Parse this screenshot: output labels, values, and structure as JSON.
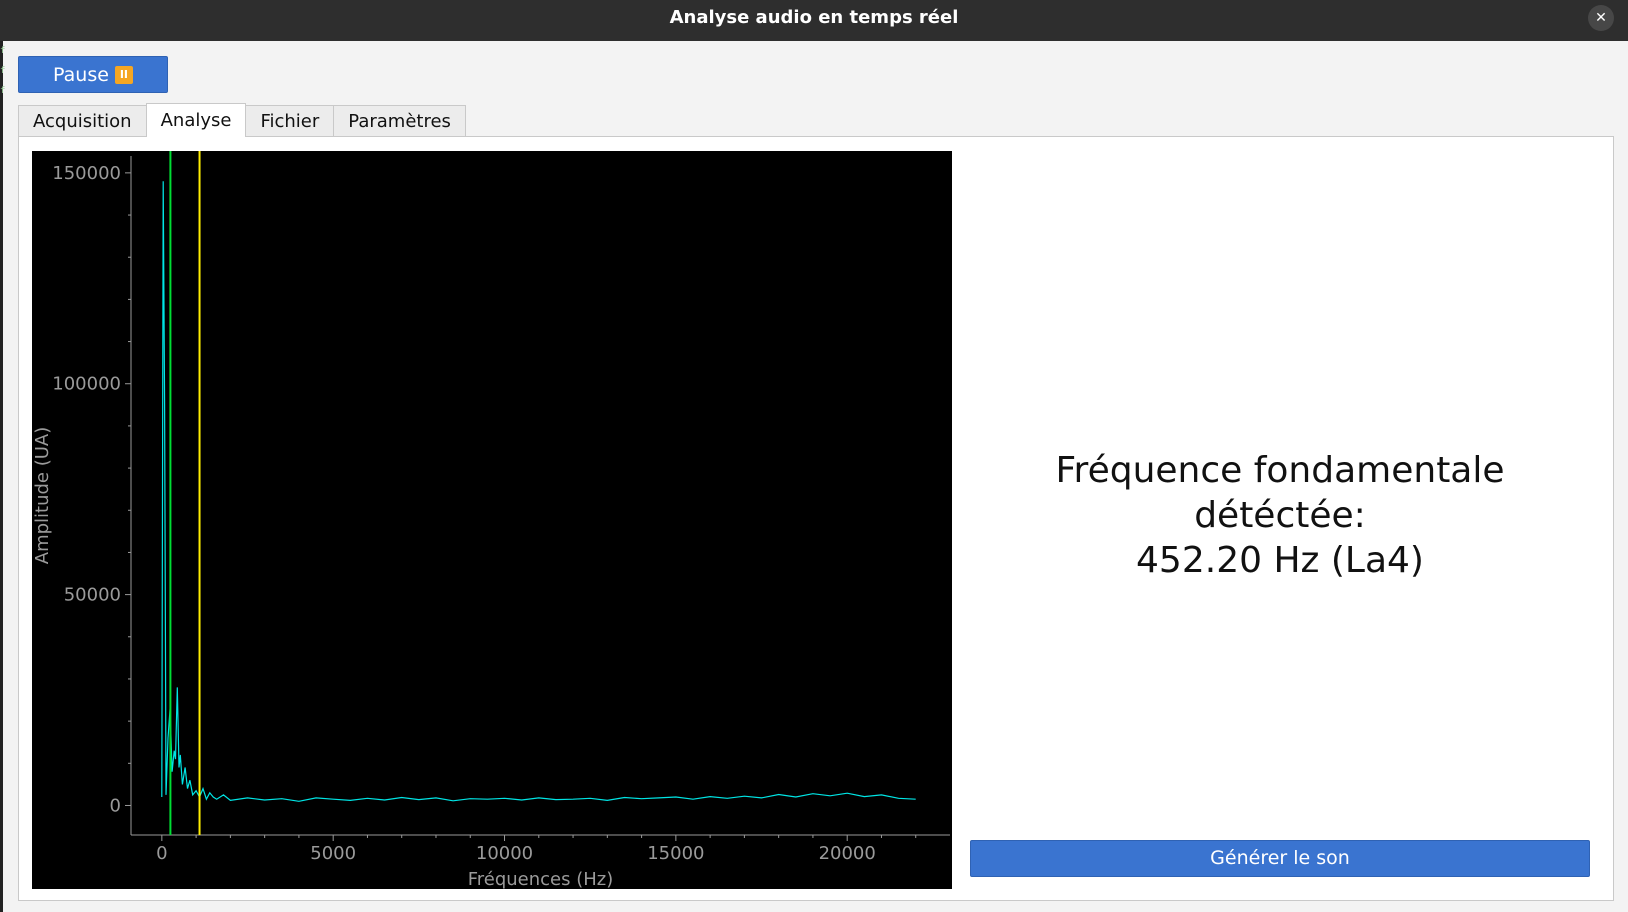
{
  "window": {
    "title": "Analyse audio en temps réel",
    "close_glyph": "✕"
  },
  "toolbar": {
    "pause_label": "Pause",
    "pause_icon": "pause-icon",
    "pause_icon_glyph": "II"
  },
  "tabs": [
    {
      "label": "Acquisition",
      "active": false
    },
    {
      "label": "Analyse",
      "active": true
    },
    {
      "label": "Fichier",
      "active": false
    },
    {
      "label": "Paramètres",
      "active": false
    }
  ],
  "result": {
    "line1": "Fréquence fondamentale détéctée:",
    "line2": "452.20 Hz (La4)"
  },
  "generate_button": "Générer le son",
  "colors": {
    "accent": "#3a74d0",
    "spectrum": "#00e5e5",
    "marker_green": "#00dd33",
    "marker_yellow": "#ffee00"
  },
  "chart_data": {
    "type": "line",
    "title": "",
    "xlabel": "Fréquences (Hz)",
    "ylabel": "Amplitude (UA)",
    "xlim": [
      -900,
      23000
    ],
    "ylim": [
      -7000,
      154000
    ],
    "xticks": [
      0,
      5000,
      10000,
      15000,
      20000
    ],
    "yticks": [
      0,
      50000,
      100000,
      150000
    ],
    "grid": false,
    "markers": [
      {
        "x": 250,
        "color": "#00dd33"
      },
      {
        "x": 1100,
        "color": "#ffee00"
      }
    ],
    "series": [
      {
        "x": [
          0,
          40,
          80,
          120,
          180,
          240,
          300,
          360,
          400,
          452,
          500,
          540,
          600,
          680,
          750,
          820,
          900,
          1000,
          1100,
          1200,
          1300,
          1400,
          1500,
          1600,
          1800,
          2000,
          2500,
          3000,
          3500,
          4000,
          4500,
          5000,
          5500,
          6000,
          6500,
          7000,
          7500,
          8000,
          8500,
          9000,
          9500,
          10000,
          10500,
          11000,
          11500,
          12000,
          12500,
          13000,
          13500,
          14000,
          14500,
          15000,
          15500,
          16000,
          16500,
          17000,
          17500,
          18000,
          18500,
          19000,
          19500,
          20000,
          20500,
          21000,
          21500,
          22000
        ],
        "y": [
          2000,
          148000,
          95000,
          2500,
          16000,
          23000,
          8000,
          13000,
          11000,
          28000,
          9000,
          12000,
          5000,
          9000,
          4000,
          6000,
          2500,
          3500,
          2000,
          4000,
          1500,
          3000,
          2000,
          1500,
          2500,
          1200,
          1800,
          1300,
          1600,
          1000,
          1800,
          1500,
          1200,
          1700,
          1300,
          1900,
          1400,
          1800,
          1100,
          1600,
          1500,
          1700,
          1300,
          1800,
          1400,
          1500,
          1700,
          1200,
          1900,
          1600,
          1800,
          2000,
          1500,
          2100,
          1700,
          2200,
          1800,
          2600,
          2000,
          2800,
          2300,
          2900,
          2100,
          2500,
          1700,
          1500
        ]
      }
    ]
  }
}
